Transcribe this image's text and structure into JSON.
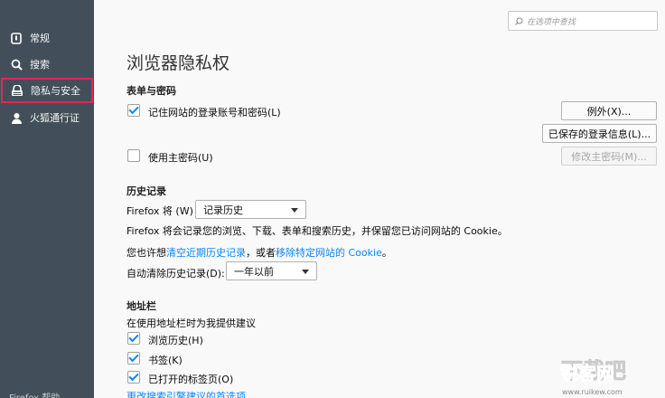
{
  "sidebar": {
    "items": [
      {
        "label": "常规",
        "icon": "general-icon"
      },
      {
        "label": "搜索",
        "icon": "search-icon"
      },
      {
        "label": "隐私与安全",
        "icon": "lock-icon"
      },
      {
        "label": "火狐通行证",
        "icon": "account-icon"
      }
    ],
    "bottom_text": "Firefox 帮助"
  },
  "search": {
    "placeholder": "在选项中查找"
  },
  "page_title": "浏览器隐私权",
  "forms": {
    "heading": "表单与密码",
    "remember_logins": {
      "label": "记住网站的登录账号和密码(L)",
      "checked": true
    },
    "exceptions_button": "例外(X)...",
    "saved_logins_button": "已保存的登录信息(L)...",
    "master_password": {
      "label": "使用主密码(U)",
      "checked": false
    },
    "change_master_button": "修改主密码(M)..."
  },
  "history": {
    "heading": "历史记录",
    "firefox_will_label": "Firefox 将 (W)",
    "mode_value": "记录历史",
    "description": "Firefox 将会记录您的浏览、下载、表单和搜索历史，并保留您已访问网站的 Cookie。",
    "maybe_prefix": "您也许想",
    "clear_recent_link": "清空近期历史记录",
    "maybe_middle": "，或者",
    "remove_cookies_link": "移除特定网站的 Cookie",
    "maybe_suffix": "。",
    "auto_clear_label": "自动清除历史记录(D):",
    "auto_clear_value": "一年以前"
  },
  "address_bar": {
    "heading": "地址栏",
    "description": "在使用地址栏时为我提供建议",
    "options": [
      {
        "label": "浏览历史(H)",
        "checked": true
      },
      {
        "label": "书签(K)",
        "checked": true
      },
      {
        "label": "已打开的标签页(O)",
        "checked": true
      }
    ],
    "change_link": "更改搜索引擎建议的首选项"
  },
  "watermark": {
    "text": "锐客网",
    "url_text": "www.ruikew.com"
  },
  "colors": {
    "sidebar": "#424f5a",
    "accent": "#0a84ff",
    "selected_outline": "#e22850",
    "background": "#f9f9fa"
  }
}
